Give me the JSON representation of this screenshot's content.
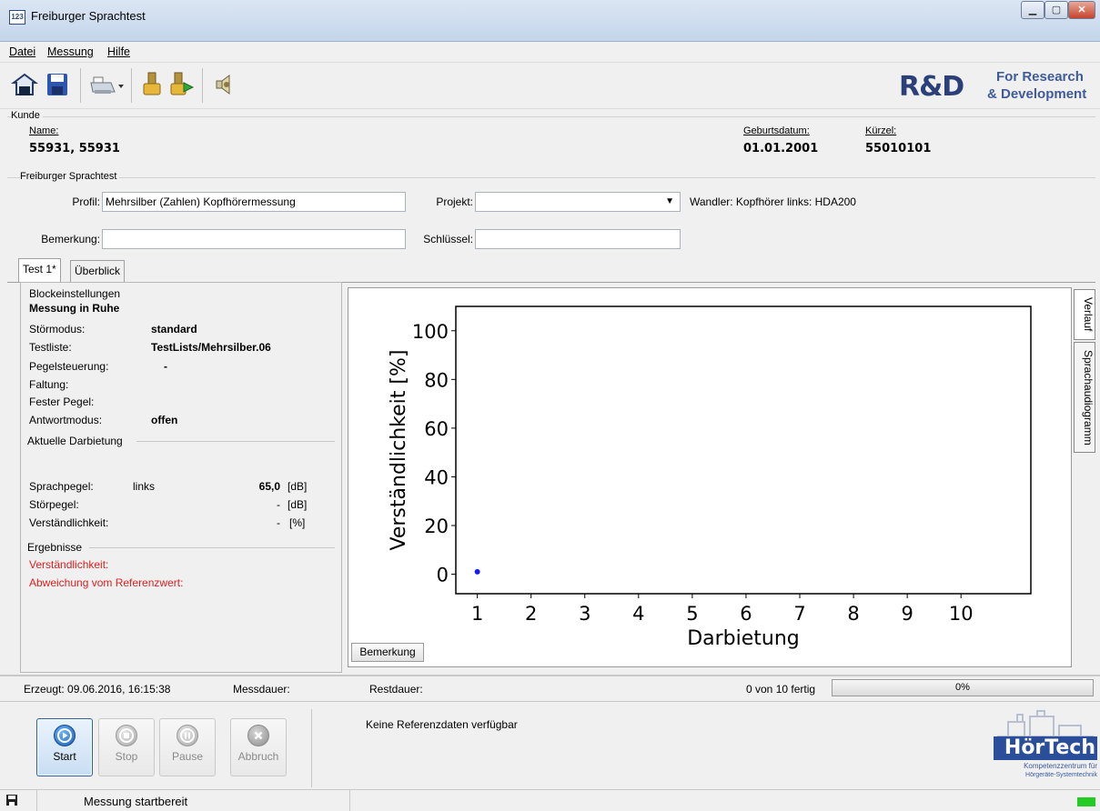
{
  "window": {
    "title": "Freiburger Sprachtest",
    "icon_text": "123"
  },
  "menu": [
    "Datei",
    "Messung",
    "Hilfe"
  ],
  "toolbar": {
    "buttons": [
      "open-icon",
      "save-icon",
      "print-icon",
      "print-dropdown-icon",
      "import-icon",
      "export-icon",
      "speaker-icon"
    ]
  },
  "logo": {
    "big": "R&D",
    "line1": "For Research",
    "line2": "& Development"
  },
  "kunde": {
    "legend": "Kunde",
    "name_label": "Name:",
    "name_value": "55931, 55931",
    "birth_label": "Geburtsdatum:",
    "birth_value": "01.01.2001",
    "kuerzel_label": "Kürzel:",
    "kuerzel_value": "55010101"
  },
  "fst": {
    "legend": "Freiburger Sprachtest",
    "profil_label": "Profil:",
    "profil_value": "Mehrsilber (Zahlen) Kopfhörermessung",
    "projekt_label": "Projekt:",
    "projekt_value": "",
    "wandler": "Wandler: Kopfhörer  links: HDA200",
    "bemerkung_label": "Bemerkung:",
    "bemerkung_value": "",
    "schluessel_label": "Schlüssel:",
    "schluessel_value": ""
  },
  "tabs": [
    "Test 1*",
    "Überblick"
  ],
  "block": {
    "legend": "Blockeinstellungen",
    "heading": "Messung in Ruhe",
    "rows": [
      {
        "label": "Störmodus:",
        "value": "standard"
      },
      {
        "label": "Testliste:",
        "value": "TestLists/Mehrsilber.06"
      },
      {
        "label": "Pegelsteuerung:",
        "value": "-"
      },
      {
        "label": "Faltung:",
        "value": ""
      },
      {
        "label": "Fester Pegel:",
        "value": ""
      },
      {
        "label": "Antwortmodus:",
        "value": "offen"
      }
    ]
  },
  "current": {
    "legend": "Aktuelle Darbietung",
    "sprach_label": "Sprachpegel:",
    "sprach_side": "links",
    "sprach_value": "65,0",
    "sprach_unit": "[dB]",
    "stoer_label": "Störpegel:",
    "stoer_value": "-",
    "stoer_unit": "[dB]",
    "verst_label": "Verständlichkeit:",
    "verst_value": "-",
    "verst_unit": "[%]"
  },
  "results": {
    "legend": "Ergebnisse",
    "verst": "Verständlichkeit:",
    "abw": "Abweichung vom Referenzwert:"
  },
  "chart_data": {
    "type": "scatter",
    "xlabel": "Darbietung",
    "ylabel": "Verständlichkeit [%]",
    "xticks": [
      1,
      2,
      3,
      4,
      5,
      6,
      7,
      8,
      9,
      10
    ],
    "yticks": [
      0,
      20,
      40,
      60,
      80,
      100
    ],
    "xlim": [
      0.6,
      11.3
    ],
    "ylim": [
      -8,
      110
    ],
    "points": [
      {
        "x": 1,
        "y": 1
      }
    ],
    "point_color": "#1a1aff"
  },
  "chart": {
    "bemerkung_button": "Bemerkung"
  },
  "side_tabs": [
    "Verlauf",
    "Sprachaudiogramm"
  ],
  "status": {
    "erzeugt": "Erzeugt: 09.06.2016, 16:15:38",
    "messdauer": "Messdauer:",
    "restdauer": "Restdauer:",
    "fertig": "0 von 10 fertig",
    "progress_text": "0%",
    "progress_fraction": 0
  },
  "controls": {
    "start": "Start",
    "stop": "Stop",
    "pause": "Pause",
    "abbruch": "Abbruch"
  },
  "reference": "Keine Referenzdaten verfügbar",
  "hoertech": {
    "name": "HörTech",
    "line1": "Kompetenzzentrum für",
    "line2": "Hörgeräte-Systemtechnik"
  },
  "statusbar": {
    "message": "Messung startbereit",
    "indicator_color": "#22cc22"
  }
}
